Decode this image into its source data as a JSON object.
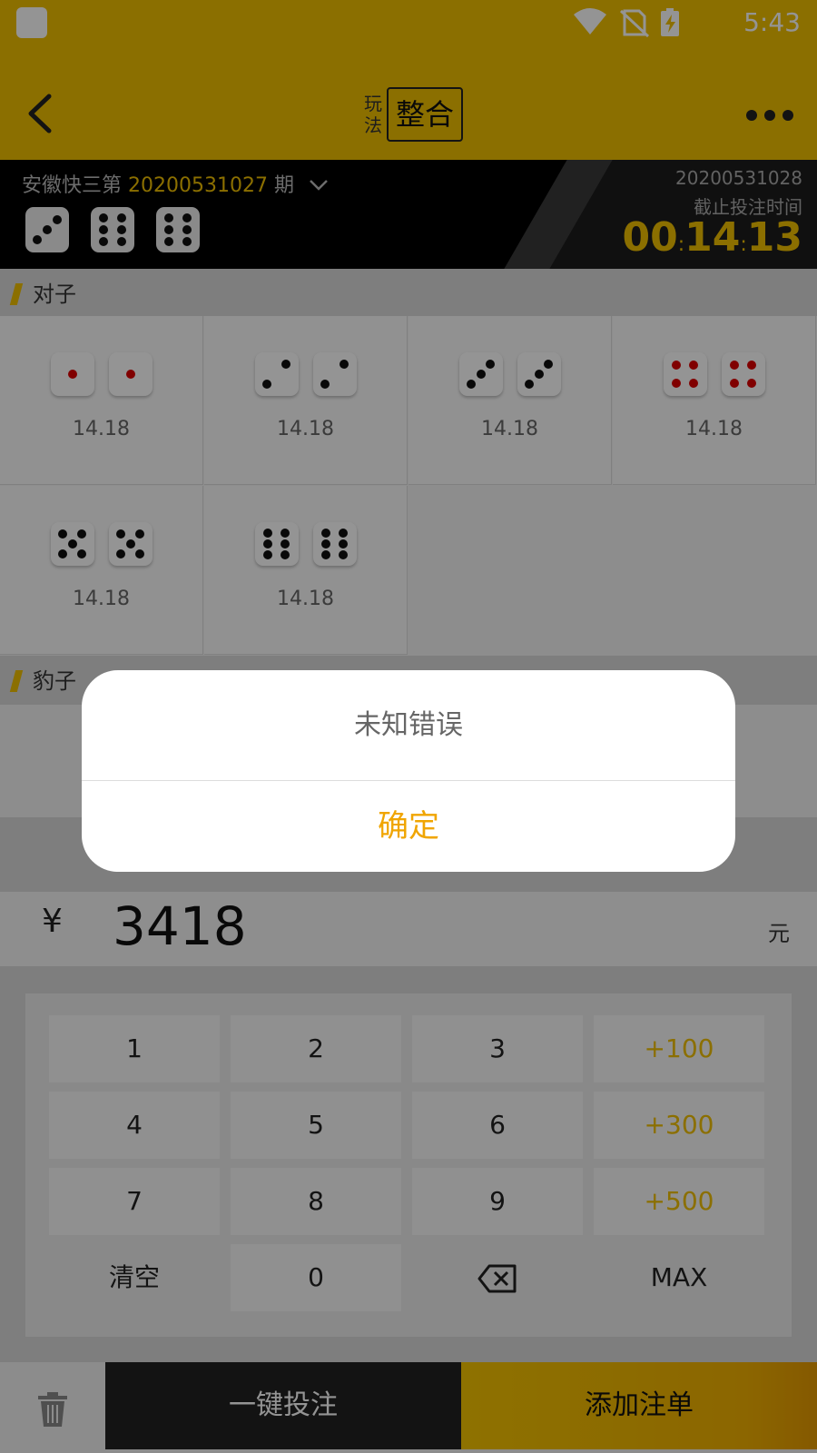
{
  "status": {
    "time": "5:43"
  },
  "header": {
    "mode_label": "玩法",
    "mode_value": "整合"
  },
  "draw": {
    "title_prefix": "安徽快三第",
    "issue": "20200531027",
    "title_suffix": "期",
    "last_dice": [
      3,
      6,
      6
    ],
    "next_issue": "20200531028",
    "deadline_label": "截止投注时间",
    "countdown": {
      "hh": "00",
      "mm": "14",
      "ss": "13"
    }
  },
  "sections": {
    "pairs_title": "对子",
    "baozi_title": "豹子"
  },
  "pairs": [
    {
      "face": 1,
      "odds": "14.18"
    },
    {
      "face": 2,
      "odds": "14.18"
    },
    {
      "face": 3,
      "odds": "14.18"
    },
    {
      "face": 4,
      "odds": "14.18"
    },
    {
      "face": 5,
      "odds": "14.18"
    },
    {
      "face": 6,
      "odds": "14.18"
    }
  ],
  "amount": {
    "currency": "¥",
    "value": "3418",
    "unit": "元"
  },
  "keypad": {
    "k1": "1",
    "k2": "2",
    "k3": "3",
    "p100": "+100",
    "k4": "4",
    "k5": "5",
    "k6": "6",
    "p300": "+300",
    "k7": "7",
    "k8": "8",
    "k9": "9",
    "p500": "+500",
    "clear": "清空",
    "k0": "0",
    "max": "MAX"
  },
  "footer": {
    "quick_bet": "一键投注",
    "add_order": "添加注单"
  },
  "dialog": {
    "message": "未知错误",
    "confirm": "确定"
  },
  "colors": {
    "brand": "#f0bf00",
    "dialog_confirm": "#f0a500",
    "red_pip": "#dd0000"
  }
}
